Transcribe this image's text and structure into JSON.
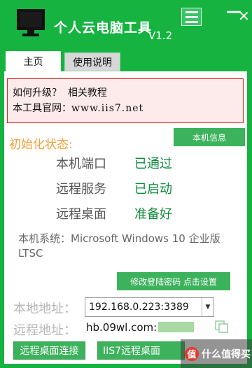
{
  "window": {
    "title": "个人云电脑工具",
    "version": "V1.2",
    "minimize_glyph": "—",
    "close_glyph": "✕"
  },
  "tabs": [
    {
      "label": "主页",
      "active": true
    },
    {
      "label": "使用说明",
      "active": false
    }
  ],
  "notice": {
    "line1_prefix": "如何升级？",
    "line1_link": "相关教程",
    "line2_prefix": "本工具官网：",
    "line2_site": "www.iis7.net"
  },
  "init_label": "初始化状态:",
  "local_info_button": "本机信息",
  "status": [
    {
      "label": "本机端口",
      "value": "已通过"
    },
    {
      "label": "远程服务",
      "value": "已启动"
    },
    {
      "label": "远程桌面",
      "value": "准备好"
    }
  ],
  "system_info": "本机系统：Microsoft Windows 10 企业版 LTSC",
  "change_password_button": "修改登陆密码 点击设置",
  "address": {
    "local_label": "本地地址：",
    "local_value": "192.168.0.223:3389",
    "remote_label": "远程地址：",
    "remote_value": "hb.09wl.com:"
  },
  "buttons": {
    "remote_connect": "远程桌面连接",
    "iis7_remote": "IIS7远程桌面"
  },
  "watermark": {
    "badge": "值",
    "text": "什么值得买"
  },
  "colors": {
    "window_green": "#16b341",
    "button_green": "#3cb25c",
    "status_green": "#0e8a3a",
    "init_orange": "#f0a13c",
    "notice_border": "#e02020",
    "notice_bg": "#fdeaea"
  }
}
